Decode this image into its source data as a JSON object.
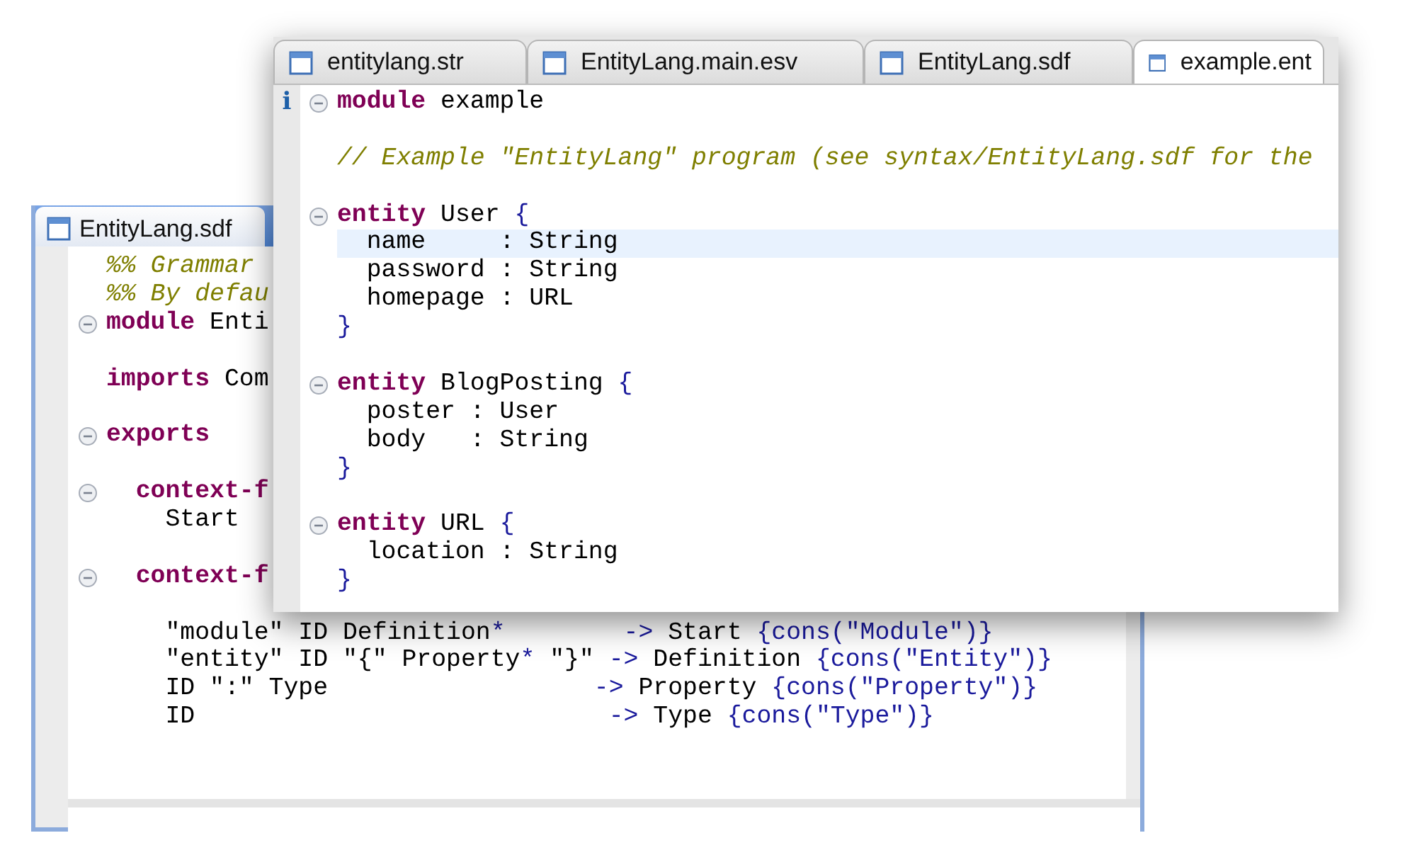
{
  "back_window": {
    "tab": {
      "label": "EntityLang.sdf"
    },
    "lines": [
      {
        "kind": "code",
        "fold": false,
        "tokens": [
          {
            "kind": "comment",
            "text": "%% Grammar"
          }
        ]
      },
      {
        "kind": "code",
        "fold": false,
        "tokens": [
          {
            "kind": "comment",
            "text": "%% By defau"
          }
        ]
      },
      {
        "kind": "code",
        "fold": true,
        "tokens": [
          {
            "kind": "keyword",
            "text": "module"
          },
          {
            "kind": "plain",
            "text": " Enti"
          }
        ]
      },
      {
        "kind": "blank"
      },
      {
        "kind": "code",
        "fold": false,
        "tokens": [
          {
            "kind": "keyword",
            "text": "imports"
          },
          {
            "kind": "plain",
            "text": " Com"
          }
        ]
      },
      {
        "kind": "blank"
      },
      {
        "kind": "code",
        "fold": true,
        "tokens": [
          {
            "kind": "keyword",
            "text": "exports"
          }
        ]
      },
      {
        "kind": "blank"
      },
      {
        "kind": "code",
        "fold": true,
        "tokens": [
          {
            "kind": "keyword",
            "text": "  context-f"
          }
        ]
      },
      {
        "kind": "code",
        "fold": false,
        "tokens": [
          {
            "kind": "plain",
            "text": "    Start"
          }
        ]
      },
      {
        "kind": "blank"
      },
      {
        "kind": "code",
        "fold": true,
        "tokens": [
          {
            "kind": "keyword",
            "text": "  context-f"
          }
        ]
      },
      {
        "kind": "blank"
      },
      {
        "kind": "code",
        "fold": false,
        "tokens": [
          {
            "kind": "plain",
            "text": "    \"module\" ID Definition"
          },
          {
            "kind": "symbol",
            "text": "*"
          },
          {
            "kind": "symbol",
            "text": "        ->"
          },
          {
            "kind": "plain",
            "text": " Start "
          },
          {
            "kind": "symbol",
            "text": "{cons(\"Module\")}"
          }
        ]
      },
      {
        "kind": "code",
        "fold": false,
        "tokens": [
          {
            "kind": "plain",
            "text": "    \"entity\" ID \"{\" Property"
          },
          {
            "kind": "symbol",
            "text": "*"
          },
          {
            "kind": "plain",
            "text": " \"}\" "
          },
          {
            "kind": "symbol",
            "text": "->"
          },
          {
            "kind": "plain",
            "text": " Definition "
          },
          {
            "kind": "symbol",
            "text": "{cons(\"Entity\")}"
          }
        ]
      },
      {
        "kind": "code",
        "fold": false,
        "tokens": [
          {
            "kind": "plain",
            "text": "    ID \":\" Type                  "
          },
          {
            "kind": "symbol",
            "text": "->"
          },
          {
            "kind": "plain",
            "text": " Property "
          },
          {
            "kind": "symbol",
            "text": "{cons(\"Property\")}"
          }
        ]
      },
      {
        "kind": "code",
        "fold": false,
        "tokens": [
          {
            "kind": "plain",
            "text": "    ID                            "
          },
          {
            "kind": "symbol",
            "text": "->"
          },
          {
            "kind": "plain",
            "text": " Type "
          },
          {
            "kind": "symbol",
            "text": "{cons(\"Type\")}"
          }
        ]
      }
    ]
  },
  "front_window": {
    "tabs": [
      {
        "label": "entitylang.str",
        "selected": false
      },
      {
        "label": "EntityLang.main.esv",
        "selected": false
      },
      {
        "label": "EntityLang.sdf",
        "selected": false
      },
      {
        "label": "example.ent",
        "selected": true
      }
    ],
    "lines": [
      {
        "kind": "code",
        "fold": true,
        "current": false,
        "annotation": "i",
        "tokens": [
          {
            "kind": "keyword",
            "text": "module"
          },
          {
            "kind": "plain",
            "text": " example"
          }
        ]
      },
      {
        "kind": "blank"
      },
      {
        "kind": "code",
        "fold": false,
        "current": false,
        "tokens": [
          {
            "kind": "comment",
            "text": "// Example \"EntityLang\" program (see syntax/EntityLang.sdf for the"
          }
        ]
      },
      {
        "kind": "blank"
      },
      {
        "kind": "code",
        "fold": true,
        "current": false,
        "tokens": [
          {
            "kind": "keyword",
            "text": "entity"
          },
          {
            "kind": "plain",
            "text": " User "
          },
          {
            "kind": "symbol",
            "text": "{"
          }
        ]
      },
      {
        "kind": "code",
        "fold": false,
        "current": true,
        "tokens": [
          {
            "kind": "plain",
            "text": "  name     : String"
          }
        ]
      },
      {
        "kind": "code",
        "fold": false,
        "current": false,
        "tokens": [
          {
            "kind": "plain",
            "text": "  password : String"
          }
        ]
      },
      {
        "kind": "code",
        "fold": false,
        "current": false,
        "tokens": [
          {
            "kind": "plain",
            "text": "  homepage : URL"
          }
        ]
      },
      {
        "kind": "code",
        "fold": false,
        "current": false,
        "tokens": [
          {
            "kind": "symbol",
            "text": "}"
          }
        ]
      },
      {
        "kind": "blank"
      },
      {
        "kind": "code",
        "fold": true,
        "current": false,
        "tokens": [
          {
            "kind": "keyword",
            "text": "entity"
          },
          {
            "kind": "plain",
            "text": " BlogPosting "
          },
          {
            "kind": "symbol",
            "text": "{"
          }
        ]
      },
      {
        "kind": "code",
        "fold": false,
        "current": false,
        "tokens": [
          {
            "kind": "plain",
            "text": "  poster : User"
          }
        ]
      },
      {
        "kind": "code",
        "fold": false,
        "current": false,
        "tokens": [
          {
            "kind": "plain",
            "text": "  body   : String"
          }
        ]
      },
      {
        "kind": "code",
        "fold": false,
        "current": false,
        "tokens": [
          {
            "kind": "symbol",
            "text": "}"
          }
        ]
      },
      {
        "kind": "blank"
      },
      {
        "kind": "code",
        "fold": true,
        "current": false,
        "tokens": [
          {
            "kind": "keyword",
            "text": "entity"
          },
          {
            "kind": "plain",
            "text": " URL "
          },
          {
            "kind": "symbol",
            "text": "{"
          }
        ]
      },
      {
        "kind": "code",
        "fold": false,
        "current": false,
        "tokens": [
          {
            "kind": "plain",
            "text": "  location : String"
          }
        ]
      },
      {
        "kind": "code",
        "fold": false,
        "current": false,
        "tokens": [
          {
            "kind": "symbol",
            "text": "}"
          }
        ]
      }
    ]
  }
}
